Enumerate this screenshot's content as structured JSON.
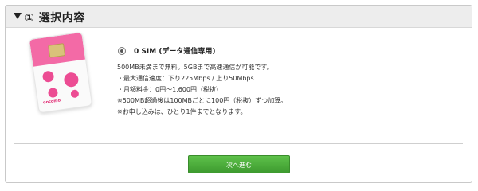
{
  "section": {
    "title": "① 選択内容"
  },
  "option": {
    "label": "0 SIM (データ通信専用)",
    "selected": true
  },
  "description": [
    "500MB未満まで無料。5GBまで高速通信が可能です。",
    "・最大通信速度：下り225Mbps / 上り50Mbps",
    "・月額料金：0円～1,600円（税抜）",
    "※500MB超過後は100MBごとに100円（税抜）ずつ加算。",
    "※お申し込みは、ひとり1件までとなります。"
  ],
  "buttons": {
    "next_label": "次へ進む"
  },
  "colors": {
    "accent": "#4caf3d",
    "sim_pink": "#f36aa6"
  }
}
